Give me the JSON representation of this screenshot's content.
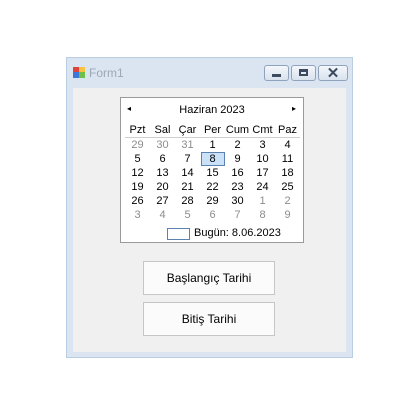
{
  "window": {
    "title": "Form1"
  },
  "calendar": {
    "month_title": "Haziran 2023",
    "nav_prev": "◂",
    "nav_next": "▸",
    "weekdays": [
      "Pzt",
      "Sal",
      "Çar",
      "Per",
      "Cum",
      "Cmt",
      "Paz"
    ],
    "weeks": [
      [
        [
          "29",
          true
        ],
        [
          "30",
          true
        ],
        [
          "31",
          true
        ],
        [
          "1",
          false
        ],
        [
          "2",
          false
        ],
        [
          "3",
          false
        ],
        [
          "4",
          false
        ]
      ],
      [
        [
          "5",
          false
        ],
        [
          "6",
          false
        ],
        [
          "7",
          false
        ],
        [
          "8",
          false
        ],
        [
          "9",
          false
        ],
        [
          "10",
          false
        ],
        [
          "11",
          false
        ]
      ],
      [
        [
          "12",
          false
        ],
        [
          "13",
          false
        ],
        [
          "14",
          false
        ],
        [
          "15",
          false
        ],
        [
          "16",
          false
        ],
        [
          "17",
          false
        ],
        [
          "18",
          false
        ]
      ],
      [
        [
          "19",
          false
        ],
        [
          "20",
          false
        ],
        [
          "21",
          false
        ],
        [
          "22",
          false
        ],
        [
          "23",
          false
        ],
        [
          "24",
          false
        ],
        [
          "25",
          false
        ]
      ],
      [
        [
          "26",
          false
        ],
        [
          "27",
          false
        ],
        [
          "28",
          false
        ],
        [
          "29",
          false
        ],
        [
          "30",
          false
        ],
        [
          "1",
          true
        ],
        [
          "2",
          true
        ]
      ],
      [
        [
          "3",
          true
        ],
        [
          "4",
          true
        ],
        [
          "5",
          true
        ],
        [
          "6",
          true
        ],
        [
          "7",
          true
        ],
        [
          "8",
          true
        ],
        [
          "9",
          true
        ]
      ]
    ],
    "selected_day": "8",
    "today_text": "Bugün: 8.06.2023"
  },
  "buttons": {
    "start_label": "Başlangıç Tarihi",
    "end_label": "Bitiş Tarihi"
  },
  "icons": {
    "app": "form-app-icon",
    "minimize": "minimize-icon",
    "maximize": "maximize-icon",
    "close": "close-icon"
  }
}
